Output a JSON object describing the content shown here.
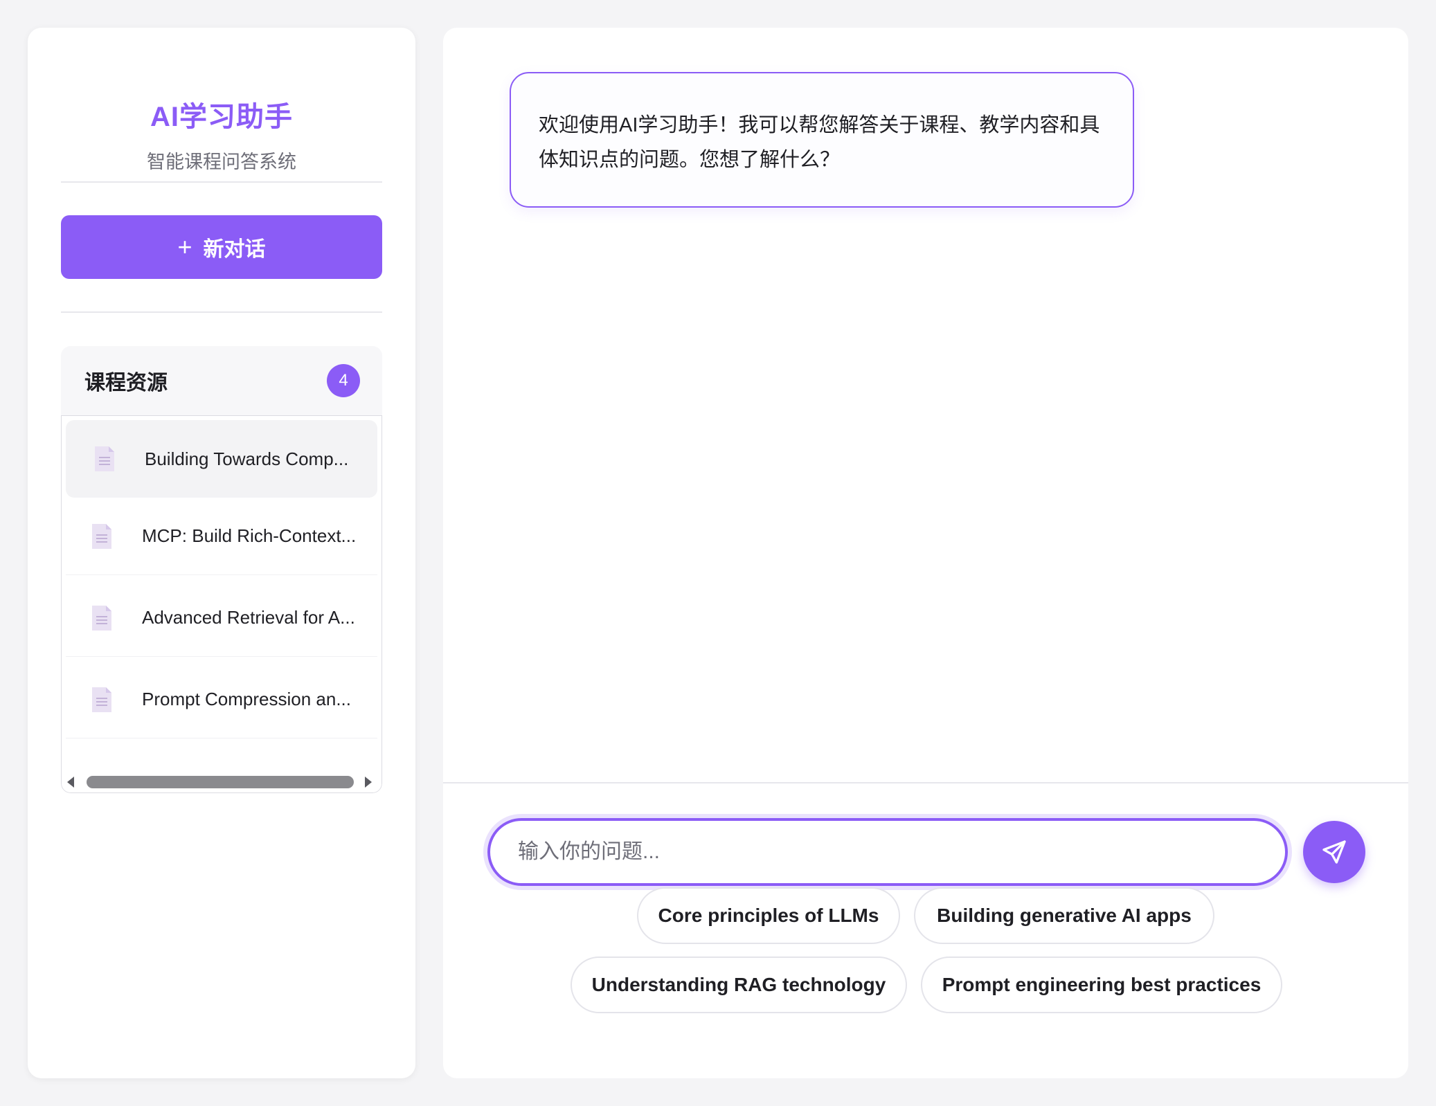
{
  "sidebar": {
    "title": "AI学习助手",
    "subtitle": "智能课程问答系统",
    "new_chat": {
      "icon": "plus-icon",
      "label": "新对话",
      "plus": "+"
    },
    "resources": {
      "title": "课程资源",
      "count": "4",
      "items": [
        {
          "label": "Building Towards Comp...",
          "icon": "document-icon"
        },
        {
          "label": "MCP: Build Rich-Context...",
          "icon": "document-icon"
        },
        {
          "label": "Advanced Retrieval for A...",
          "icon": "document-icon"
        },
        {
          "label": "Prompt Compression an...",
          "icon": "document-icon"
        }
      ]
    }
  },
  "chat": {
    "welcome_message": "欢迎使用AI学习助手！我可以帮您解答关于课程、教学内容和具体知识点的问题。您想了解什么？",
    "input": {
      "placeholder": "输入你的问题...",
      "value": ""
    },
    "send_icon": "send-icon",
    "suggestions": [
      "Core principles of LLMs",
      "Building generative AI apps",
      "Understanding RAG technology",
      "Prompt engineering best practices"
    ]
  },
  "colors": {
    "accent": "#8b5cf6",
    "background": "#f4f4f6"
  }
}
